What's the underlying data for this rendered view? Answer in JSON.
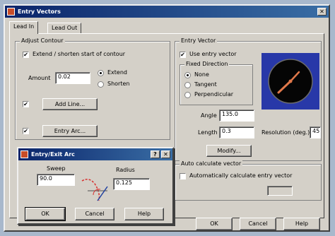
{
  "main_dialog": {
    "title": "Entry Vectors",
    "close_glyph": "✕",
    "tabs": [
      "Lead In",
      "Lead Out"
    ],
    "adjust_contour": {
      "group_label": "Adjust Contour",
      "extend_label": "Extend / shorten start of contour",
      "extend_checked_glyph": "✔",
      "amount_label": "Amount",
      "amount_value": "0.02",
      "radio_extend": "Extend",
      "radio_shorten": "Shorten",
      "add_line_label": "Add Line...",
      "entry_arc_label": "Entry Arc...",
      "check_glyph": "✔"
    },
    "entry_vector": {
      "group_label": "Entry Vector",
      "use_label": "Use entry vector",
      "fixed_direction_label": "Fixed Direction",
      "radio_none": "None",
      "radio_tangent": "Tangent",
      "radio_perpendicular": "Perpendicular",
      "angle_label": "Angle",
      "angle_value": "135.0",
      "length_label": "Length",
      "length_value": "0.3",
      "resolution_label": "Resolution (deg.)",
      "resolution_value": "45",
      "modify_label": "Modify...",
      "auto_group_label": "Auto calculate vector",
      "auto_label": "Automatically calculate entry vector",
      "auto_value": ""
    },
    "buttons": {
      "ok": "OK",
      "cancel": "Cancel",
      "help": "Help"
    }
  },
  "sub_dialog": {
    "title": "Entry/Exit Arc",
    "help_glyph": "?",
    "close_glyph": "✕",
    "sweep_label": "Sweep",
    "sweep_value": "90.0",
    "radius_label": "Radius",
    "radius_value": "0.125",
    "buttons": {
      "ok": "OK",
      "cancel": "Cancel",
      "help": "Help"
    }
  },
  "colors": {
    "dial_bg": "#2838a8",
    "needle": "#e0784a",
    "titlebar": "#0a246a"
  }
}
